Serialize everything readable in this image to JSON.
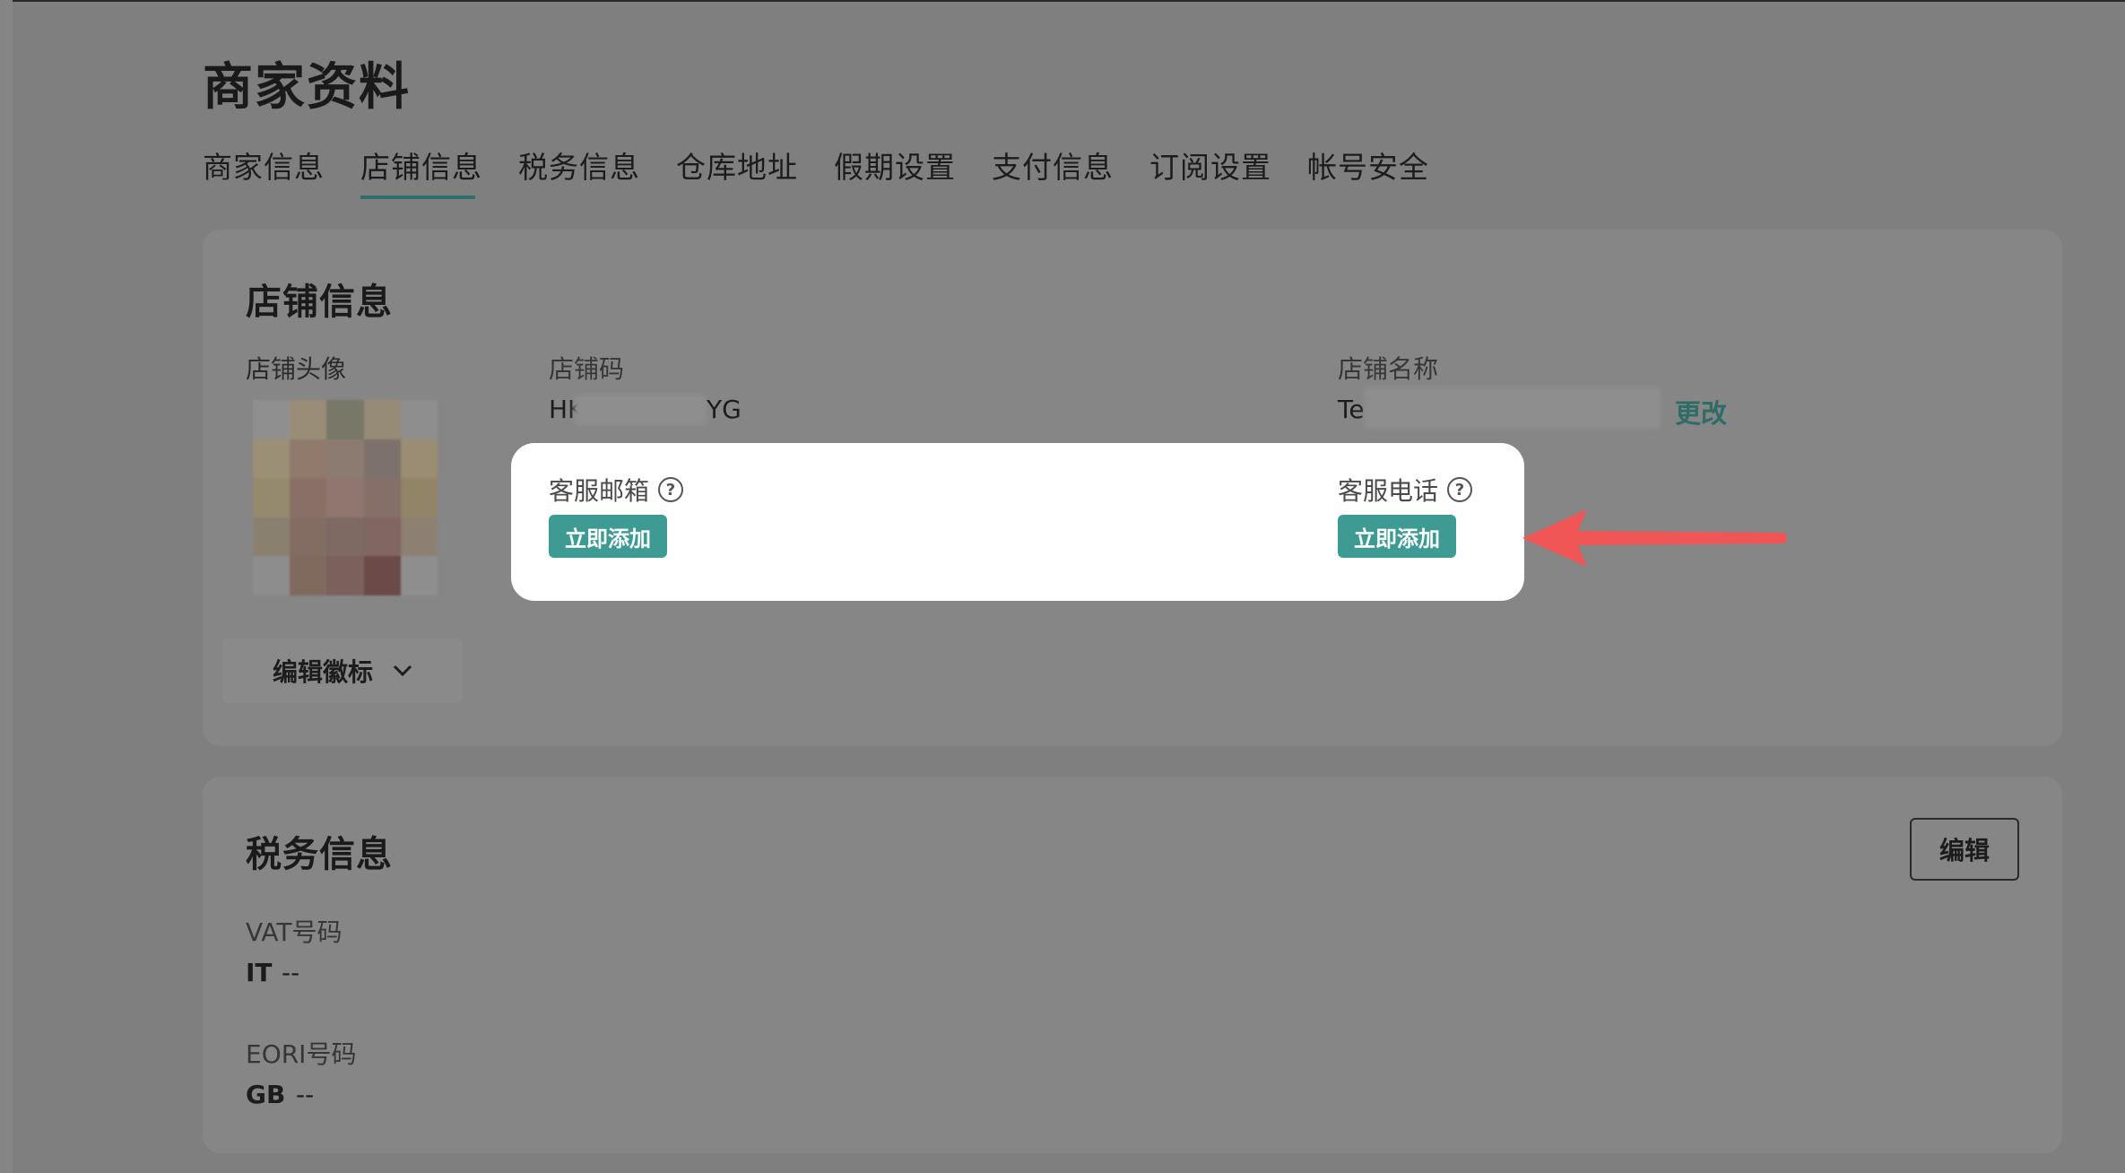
{
  "page": {
    "title": "商家资料"
  },
  "tabs": [
    {
      "label": "商家信息"
    },
    {
      "label": "店铺信息"
    },
    {
      "label": "税务信息"
    },
    {
      "label": "仓库地址"
    },
    {
      "label": "假期设置"
    },
    {
      "label": "支付信息"
    },
    {
      "label": "订阅设置"
    },
    {
      "label": "帐号安全"
    }
  ],
  "active_tab": "店铺信息",
  "store_info": {
    "heading": "店铺信息",
    "avatar_label": "店铺头像",
    "edit_logo_label": "编辑徽标",
    "store_code_label": "店铺码",
    "store_code_prefix": "HK",
    "store_code_suffix": "YG",
    "store_name_label": "店铺名称",
    "store_name_prefix": "Te",
    "change_link": "更改",
    "cs_email_label": "客服邮箱",
    "cs_phone_label": "客服电话",
    "add_now_label": "立即添加",
    "help_glyph": "?"
  },
  "tax_info": {
    "heading": "税务信息",
    "edit_label": "编辑",
    "vat_label": "VAT号码",
    "vat_country": "IT",
    "vat_value": "--",
    "eori_label": "EORI号码",
    "eori_country": "GB",
    "eori_value": "--"
  },
  "colors": {
    "accent": "#3d9b94",
    "link": "#2f6c68",
    "overlay": "#7f7f7f",
    "arrow": "#f05656"
  },
  "icons": {
    "dropdown": "chevron-down-icon",
    "help": "question-circle-icon",
    "annotation": "red-arrow-icon"
  }
}
